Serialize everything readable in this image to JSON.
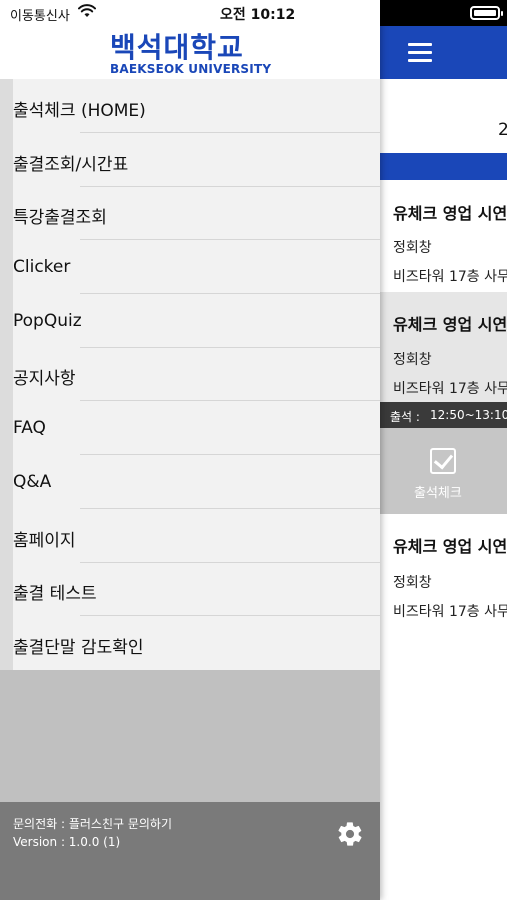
{
  "status_bar": {
    "carrier": "이동통신사",
    "time": "오전 10:12"
  },
  "logo": {
    "korean": "백석대학교",
    "english": "BAEKSEOK UNIVERSITY"
  },
  "menu": {
    "items": [
      {
        "label": "출석체크 (HOME)"
      },
      {
        "label": "출결조회/시간표"
      },
      {
        "label": "특강출결조회"
      },
      {
        "label": "Clicker"
      },
      {
        "label": "PopQuiz"
      },
      {
        "label": "공지사항"
      },
      {
        "label": "FAQ"
      },
      {
        "label": "Q&A"
      },
      {
        "label": "홈페이지"
      },
      {
        "label": "출결 테스트"
      },
      {
        "label": "출결단말 감도확인"
      }
    ]
  },
  "footer": {
    "contact": "문의전화 : 플러스친구 문의하기",
    "version": "Version : 1.0.0 (1)"
  },
  "main": {
    "date_partial": "2",
    "cards": [
      {
        "title": "유체크 영업 시연",
        "name": "정회창",
        "place": "비즈타워 17층 사무"
      },
      {
        "title": "유체크 영업 시연",
        "name": "정회창",
        "place": "비즈타워 17층 사무"
      },
      {
        "title": "유체크 영업 시연",
        "name": "정회창",
        "place": "비즈타워 17층 사무"
      }
    ],
    "time_label": "출석 :",
    "time_value": "12:50~13:10",
    "checkin_label": "출석체크"
  },
  "colors": {
    "brand_blue": "#1a47b8",
    "footer_gray": "#7a7a7a"
  }
}
